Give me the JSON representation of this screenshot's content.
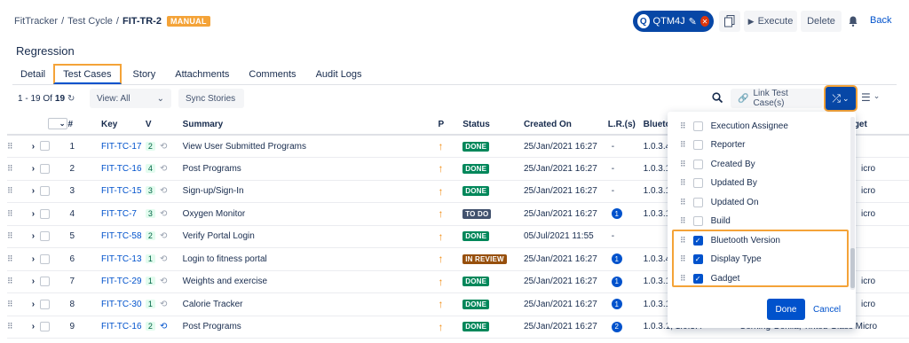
{
  "breadcrumb": {
    "app": "FitTracker",
    "sep1": "/",
    "section": "Test Cycle",
    "sep2": "/",
    "current": "FIT-TR-2",
    "badge": "MANUAL"
  },
  "header": {
    "qtm": "QTM4J",
    "execute": "Execute",
    "delete": "Delete",
    "back": "Back"
  },
  "page_title": "Regression",
  "tabs": [
    "Detail",
    "Test Cases",
    "Story",
    "Attachments",
    "Comments",
    "Audit Logs"
  ],
  "toolbar": {
    "range": "1 - 19 Of",
    "total": "19",
    "view": "View: All",
    "sync": "Sync Stories",
    "link": "Link Test Case(s)"
  },
  "columns": {
    "num": "#",
    "key": "Key",
    "v": "V",
    "summary": "Summary",
    "p": "P",
    "status": "Status",
    "created": "Created On",
    "lrs": "L.R.(s)",
    "bt": "Blueto",
    "gadget": "dget"
  },
  "rows": [
    {
      "num": "1",
      "key": "FIT-TC-17",
      "v": "2",
      "summary": "View User Submitted Programs",
      "status": "DONE",
      "created": "25/Jan/2021 16:27",
      "lr": "-",
      "bt": "1.0.3.4",
      "g": ""
    },
    {
      "num": "2",
      "key": "FIT-TC-16",
      "v": "4",
      "summary": "Post Programs",
      "status": "DONE",
      "created": "25/Jan/2021 16:27",
      "lr": "-",
      "bt": "1.0.3.1,",
      "g": "icro"
    },
    {
      "num": "3",
      "key": "FIT-TC-15",
      "v": "3",
      "summary": "Sign-up/Sign-In",
      "status": "DONE",
      "created": "25/Jan/2021 16:27",
      "lr": "-",
      "bt": "1.0.3.1,",
      "g": "icro"
    },
    {
      "num": "4",
      "key": "FIT-TC-7",
      "v": "3",
      "summary": "Oxygen Monitor",
      "status": "TO DO",
      "created": "25/Jan/2021 16:27",
      "lr": "1",
      "bt": "1.0.3.1,",
      "g": "icro"
    },
    {
      "num": "5",
      "key": "FIT-TC-58",
      "v": "2",
      "summary": "Verify Portal Login",
      "status": "DONE",
      "created": "05/Jul/2021 11:55",
      "lr": "-",
      "bt": "",
      "g": ""
    },
    {
      "num": "6",
      "key": "FIT-TC-13",
      "v": "1",
      "summary": "Login to fitness portal",
      "status": "IN REVIEW",
      "created": "25/Jan/2021 16:27",
      "lr": "1",
      "bt": "1.0.3.4",
      "g": ""
    },
    {
      "num": "7",
      "key": "FIT-TC-29",
      "v": "1",
      "summary": "Weights and exercise",
      "status": "DONE",
      "created": "25/Jan/2021 16:27",
      "lr": "1",
      "bt": "1.0.3.1,",
      "g": "icro"
    },
    {
      "num": "8",
      "key": "FIT-TC-30",
      "v": "1",
      "summary": "Calorie Tracker",
      "status": "DONE",
      "created": "25/Jan/2021 16:27",
      "lr": "1",
      "bt": "1.0.3.1,",
      "g": "icro"
    },
    {
      "num": "9",
      "key": "FIT-TC-16",
      "v": "2",
      "summary": "Post Programs",
      "status": "DONE",
      "created": "25/Jan/2021 16:27",
      "lr": "2",
      "bt": "1.0.3.1, 1.0.3.4",
      "g": "Corning Gorilla, Tinted Glass   Micro"
    }
  ],
  "column_menu": {
    "items": [
      {
        "label": "Execution Assignee",
        "checked": false
      },
      {
        "label": "Reporter",
        "checked": false
      },
      {
        "label": "Created By",
        "checked": false
      },
      {
        "label": "Updated By",
        "checked": false
      },
      {
        "label": "Updated On",
        "checked": false
      },
      {
        "label": "Build",
        "checked": false
      },
      {
        "label": "Bluetooth Version",
        "checked": true
      },
      {
        "label": "Display Type",
        "checked": true
      },
      {
        "label": "Gadget",
        "checked": true
      }
    ],
    "done": "Done",
    "cancel": "Cancel"
  },
  "colors": {
    "accent": "#0052cc",
    "highlight": "#f4a338",
    "done": "#00875a"
  }
}
